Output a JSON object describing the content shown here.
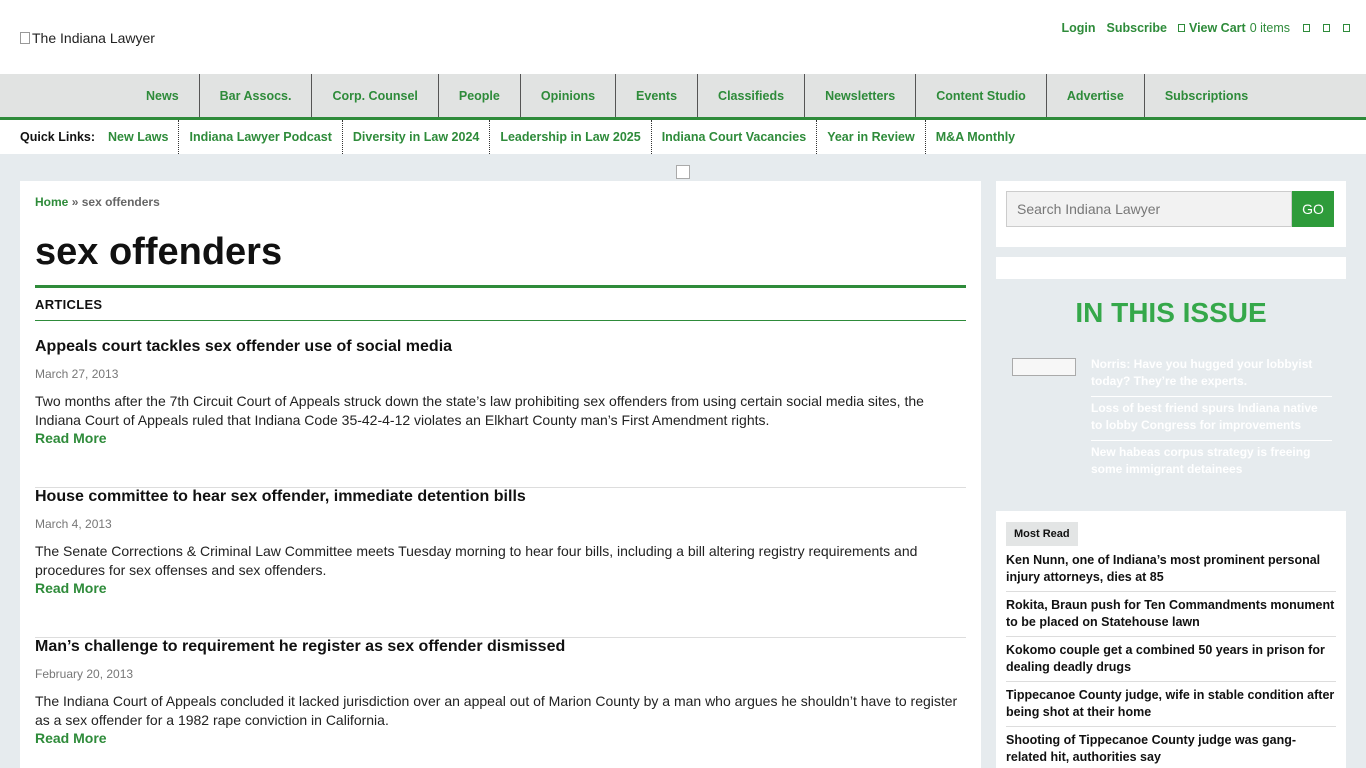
{
  "header": {
    "logo_alt": "The Indiana Lawyer",
    "login": "Login",
    "subscribe": "Subscribe",
    "view_cart": "View Cart",
    "cart_items": "0 items"
  },
  "main_nav": [
    "News",
    "Bar Assocs.",
    "Corp. Counsel",
    "People",
    "Opinions",
    "Events",
    "Classifieds",
    "Newsletters",
    "Content Studio",
    "Advertise",
    "Subscriptions"
  ],
  "quick_links": {
    "label": "Quick Links:",
    "items": [
      "New Laws",
      "Indiana Lawyer Podcast",
      "Diversity in Law 2024",
      "Leadership in Law 2025",
      "Indiana Court Vacancies",
      "Year in Review",
      "M&A Monthly"
    ]
  },
  "breadcrumb": {
    "home": "Home",
    "separator": "»",
    "current": "sex offenders"
  },
  "page_title": "sex offenders",
  "section_label": "ARTICLES",
  "articles": [
    {
      "title": "Appeals court tackles sex offender use of social media",
      "date": "March 27, 2013",
      "summary": "Two months after the 7th Circuit Court of Appeals struck down the state’s law prohibiting sex offenders from using certain social media sites, the Indiana Court of Appeals ruled that Indiana Code 35-42-4-12 violates an Elkhart County man’s First Amendment rights.",
      "more": "Read More"
    },
    {
      "title": "House committee to hear sex offender, immediate detention bills",
      "date": "March 4, 2013",
      "summary": "The Senate Corrections & Criminal Law Committee meets Tuesday morning to hear four bills, including a bill altering registry requirements and procedures for sex offenses and sex offenders.",
      "more": "Read More"
    },
    {
      "title": "Man’s challenge to requirement he register as sex offender dismissed",
      "date": "February 20, 2013",
      "summary": "The Indiana Court of Appeals concluded it lacked jurisdiction over an appeal out of Marion County by a man who argues he shouldn’t have to register as a sex offender for a 1982 rape conviction in California.",
      "more": "Read More"
    }
  ],
  "search": {
    "placeholder": "Search Indiana Lawyer",
    "button": "GO"
  },
  "in_this_issue": {
    "title": "IN THIS ISSUE",
    "items": [
      "Norris: Have you hugged your lobbyist today? They’re the experts.",
      "Loss of best friend spurs Indiana native to lobby Congress for improvements",
      "New habeas corpus strategy is freeing some immigrant detainees"
    ]
  },
  "most_read": {
    "label": "Most Read",
    "items": [
      "Ken Nunn, one of Indiana’s most prominent personal injury attorneys, dies at 85",
      "Rokita, Braun push for Ten Commandments monument to be placed on Statehouse lawn",
      "Kokomo couple get a combined 50 years in prison for dealing deadly drugs",
      "Tippecanoe County judge, wife in stable condition after being shot at their home",
      "Shooting of Tippecanoe County judge was gang-related hit, authorities say"
    ]
  },
  "colors": {
    "accent": "#2e8b3a",
    "issue_title": "#35a84a",
    "nav_bg": "#e1e3e2",
    "page_bg": "#e6ebee"
  }
}
